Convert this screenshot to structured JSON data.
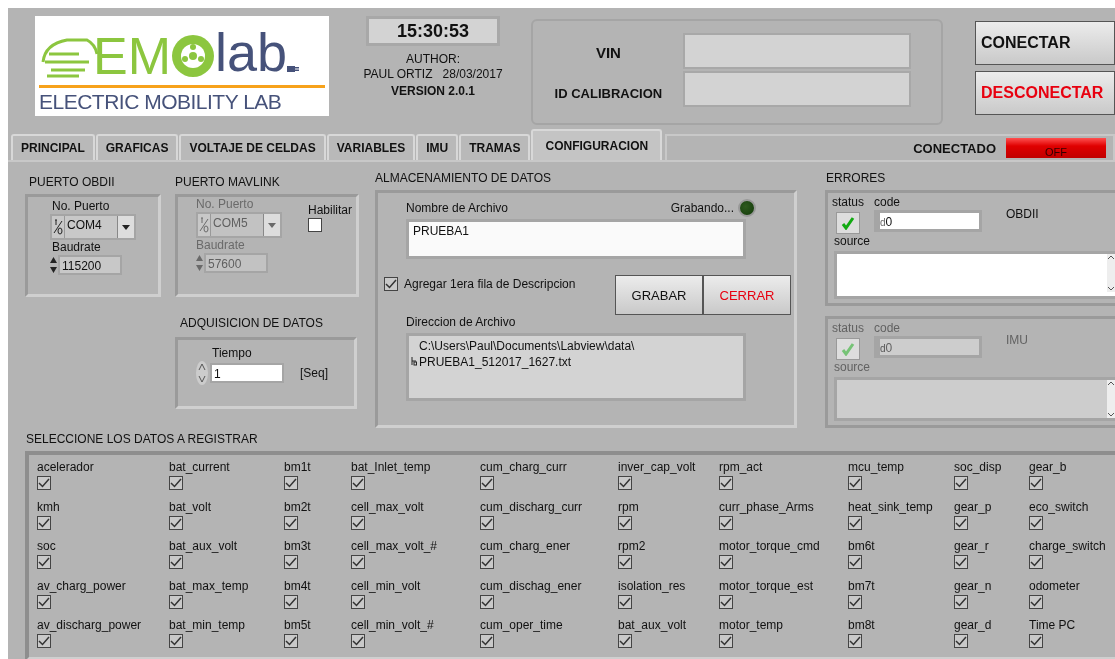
{
  "logo": {
    "brand_left": "EM",
    "brand_right": "lab",
    "subtitle": "ELECTRIC MOBILITY LAB"
  },
  "clock": "15:30:53",
  "author_label": "AUTHOR:",
  "author": "PAUL ORTIZ",
  "date": "28/03/2017",
  "version": "VERSION 2.0.1",
  "vin": {
    "label": "VIN"
  },
  "id_calibracion": {
    "label": "ID CALIBRACION"
  },
  "buttons": [
    {
      "label": "CONECTAR",
      "kind": "normal"
    },
    {
      "label": "DESCONECTAR",
      "kind": "danger"
    }
  ],
  "tabs": [
    {
      "label": "PRINCIPAL",
      "selected": false
    },
    {
      "label": "GRAFICAS",
      "selected": false
    },
    {
      "label": "VOLTAJE DE CELDAS",
      "selected": false
    },
    {
      "label": "VARIABLES",
      "selected": false
    },
    {
      "label": "IMU",
      "selected": false
    },
    {
      "label": "TRAMAS",
      "selected": false
    },
    {
      "label": "CONFIGURACION",
      "selected": true
    }
  ],
  "connection": {
    "label": "CONECTADO",
    "on": false,
    "indicator": "OFF"
  },
  "obdii": {
    "title": "PUERTO OBDII",
    "port_label": "No. Puerto",
    "port": "COM4",
    "baud_label": "Baudrate",
    "baud": "115200"
  },
  "mavlink": {
    "title": "PUERTO MAVLINK",
    "disabled": true,
    "port_label": "No. Puerto",
    "port": "COM5",
    "baud_label": "Baudrate",
    "baud": "57600",
    "enable_label": "Habilitar",
    "enabled": false
  },
  "acquisition": {
    "title": "ADQUISICION DE DATOS",
    "time_label": "Tiempo",
    "time": "1",
    "unit": "[Seq]"
  },
  "storage": {
    "title": "ALMACENAMIENTO DE DATOS",
    "filename_label": "Nombre de Archivo",
    "filename": "PRUEBA1",
    "recording_label": "Grabando...",
    "recording": false,
    "header_row": {
      "label": "Agregar 1era fila de Descripcion",
      "checked": true
    },
    "buttons": [
      {
        "label": "GRABAR",
        "kind": "normal"
      },
      {
        "label": "CERRAR",
        "kind": "danger"
      }
    ],
    "path_label": "Direccion de Archivo",
    "path_lines": [
      "C:\\Users\\Paul\\Documents\\Labview\\data\\",
      "PRUEBA1_512017_1627.txt"
    ]
  },
  "errors": {
    "title": "ERRORES",
    "clusters": [
      {
        "name": "OBDII",
        "disabled": false,
        "status_label": "status",
        "status_ok": true,
        "code_label": "code",
        "radix": "d",
        "code": "0",
        "source_label": "source"
      },
      {
        "name": "IMU",
        "disabled": true,
        "status_label": "status",
        "status_ok": true,
        "code_label": "code",
        "radix": "d",
        "code": "0",
        "source_label": "source"
      }
    ]
  },
  "select": {
    "title": "SELECCIONE LOS DATOS A REGISTRAR",
    "columns": [
      [
        {
          "label": "acelerador",
          "checked": true
        },
        {
          "label": "kmh",
          "checked": true
        },
        {
          "label": "soc",
          "checked": true
        },
        {
          "label": "av_charg_power",
          "checked": true
        },
        {
          "label": "av_discharg_power",
          "checked": true
        }
      ],
      [
        {
          "label": "bat_current",
          "checked": true
        },
        {
          "label": "bat_volt",
          "checked": true
        },
        {
          "label": "bat_aux_volt",
          "checked": true
        },
        {
          "label": "bat_max_temp",
          "checked": true
        },
        {
          "label": "bat_min_temp",
          "checked": true
        }
      ],
      [
        {
          "label": "bm1t",
          "checked": true
        },
        {
          "label": "bm2t",
          "checked": true
        },
        {
          "label": "bm3t",
          "checked": true
        },
        {
          "label": "bm4t",
          "checked": true
        },
        {
          "label": "bm5t",
          "checked": true
        }
      ],
      [
        {
          "label": "bat_Inlet_temp",
          "checked": true
        },
        {
          "label": "cell_max_volt",
          "checked": true
        },
        {
          "label": "cell_max_volt_#",
          "checked": true
        },
        {
          "label": "cell_min_volt",
          "checked": true
        },
        {
          "label": "cell_min_volt_#",
          "checked": true
        }
      ],
      [
        {
          "label": "cum_charg_curr",
          "checked": true
        },
        {
          "label": "cum_discharg_curr",
          "checked": true
        },
        {
          "label": "cum_charg_ener",
          "checked": true
        },
        {
          "label": "cum_dischag_ener",
          "checked": true
        },
        {
          "label": "cum_oper_time",
          "checked": true
        }
      ],
      [
        {
          "label": "inver_cap_volt",
          "checked": true
        },
        {
          "label": "rpm",
          "checked": true
        },
        {
          "label": "rpm2",
          "checked": true
        },
        {
          "label": "isolation_res",
          "checked": true
        },
        {
          "label": "bat_aux_volt",
          "checked": true
        }
      ],
      [
        {
          "label": "rpm_act",
          "checked": true
        },
        {
          "label": "curr_phase_Arms",
          "checked": true
        },
        {
          "label": "motor_torque_cmd",
          "checked": true
        },
        {
          "label": "motor_torque_est",
          "checked": true
        },
        {
          "label": "motor_temp",
          "checked": true
        }
      ],
      [
        {
          "label": "mcu_temp",
          "checked": true
        },
        {
          "label": "heat_sink_temp",
          "checked": true
        },
        {
          "label": "bm6t",
          "checked": true
        },
        {
          "label": "bm7t",
          "checked": true
        },
        {
          "label": "bm8t",
          "checked": true
        }
      ],
      [
        {
          "label": "soc_disp",
          "checked": true
        },
        {
          "label": "gear_p",
          "checked": true
        },
        {
          "label": "gear_r",
          "checked": true
        },
        {
          "label": "gear_n",
          "checked": true
        },
        {
          "label": "gear_d",
          "checked": true
        }
      ],
      [
        {
          "label": "gear_b",
          "checked": true
        },
        {
          "label": "eco_switch",
          "checked": true
        },
        {
          "label": "charge_switch",
          "checked": true
        },
        {
          "label": "odometer",
          "checked": true
        },
        {
          "label": "Time PC",
          "checked": true
        }
      ]
    ]
  }
}
